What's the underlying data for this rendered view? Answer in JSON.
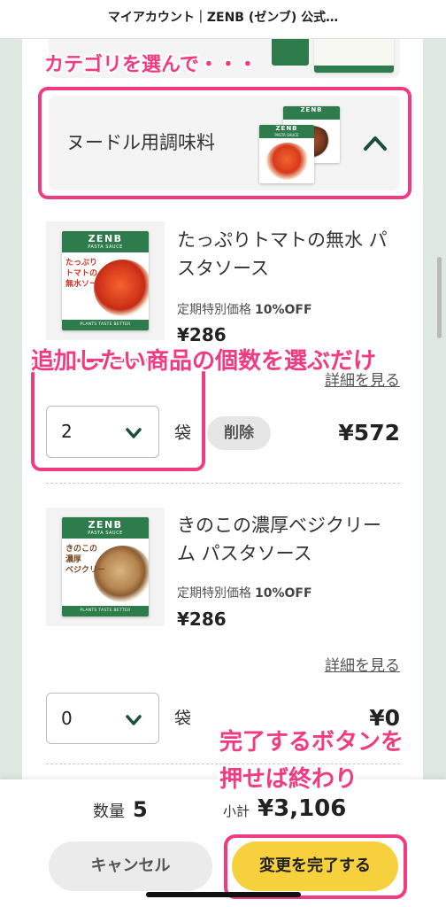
{
  "header": {
    "title": "マイアカウント｜ZENB (ゼンブ) 公式…"
  },
  "annotations": {
    "category_hint": "カテゴリを選んで・・・",
    "quantity_hint": "追加したい商品の個数を選ぶだけ",
    "complete_hint_line1": "完了するボタンを",
    "complete_hint_line2": "押せば終わり",
    "highlight_color": "#f03a82"
  },
  "category": {
    "label": "ヌードル用調味料",
    "expanded": true,
    "toggle_icon": "chevron-up-icon",
    "thumbnails": [
      {
        "brand": "ZENB",
        "line": "PASTA SAUCE"
      },
      {
        "brand": "ZENB"
      }
    ]
  },
  "products": [
    {
      "name": "たっぷりトマトの無水 パスタソース",
      "price_label": "定期特別価格",
      "discount": "10%OFF",
      "unit_price": "¥286",
      "detail_link": "詳細を見る",
      "quantity": "2",
      "unit": "袋",
      "remove_label": "削除",
      "line_total": "¥572",
      "quantity_icon": "chevron-down-icon",
      "package": {
        "brand": "ZENB",
        "line": "PASTA SAUCE",
        "copy": [
          "たっぷり",
          "トマトの",
          "無水ソース"
        ],
        "tagline": "PLANTS TASTE BETTER",
        "accent_color": "#d2352a"
      }
    },
    {
      "name": "きのこの濃厚ベジクリーム パスタソース",
      "price_label": "定期特別価格",
      "discount": "10%OFF",
      "unit_price": "¥286",
      "detail_link": "詳細を見る",
      "quantity": "0",
      "unit": "袋",
      "line_total": "¥0",
      "quantity_icon": "chevron-down-icon",
      "package": {
        "brand": "ZENB",
        "line": "PASTA SAUCE",
        "copy": [
          "きのこの",
          "濃厚",
          "ベジクリー"
        ],
        "tagline": "PLANTS TASTE BETTER",
        "accent_color": "#7a4a22"
      }
    }
  ],
  "summary": {
    "quantity_label": "数量",
    "quantity_value": "5",
    "subtotal_label": "小計",
    "subtotal_value": "¥3,106"
  },
  "actions": {
    "cancel_label": "キャンセル",
    "confirm_label": "変更を完了する"
  },
  "colors": {
    "accent_green": "#1a5038",
    "brand_green": "#2e7b4c",
    "confirm_yellow": "#f6d03d",
    "page_background": "#dde8e0"
  }
}
